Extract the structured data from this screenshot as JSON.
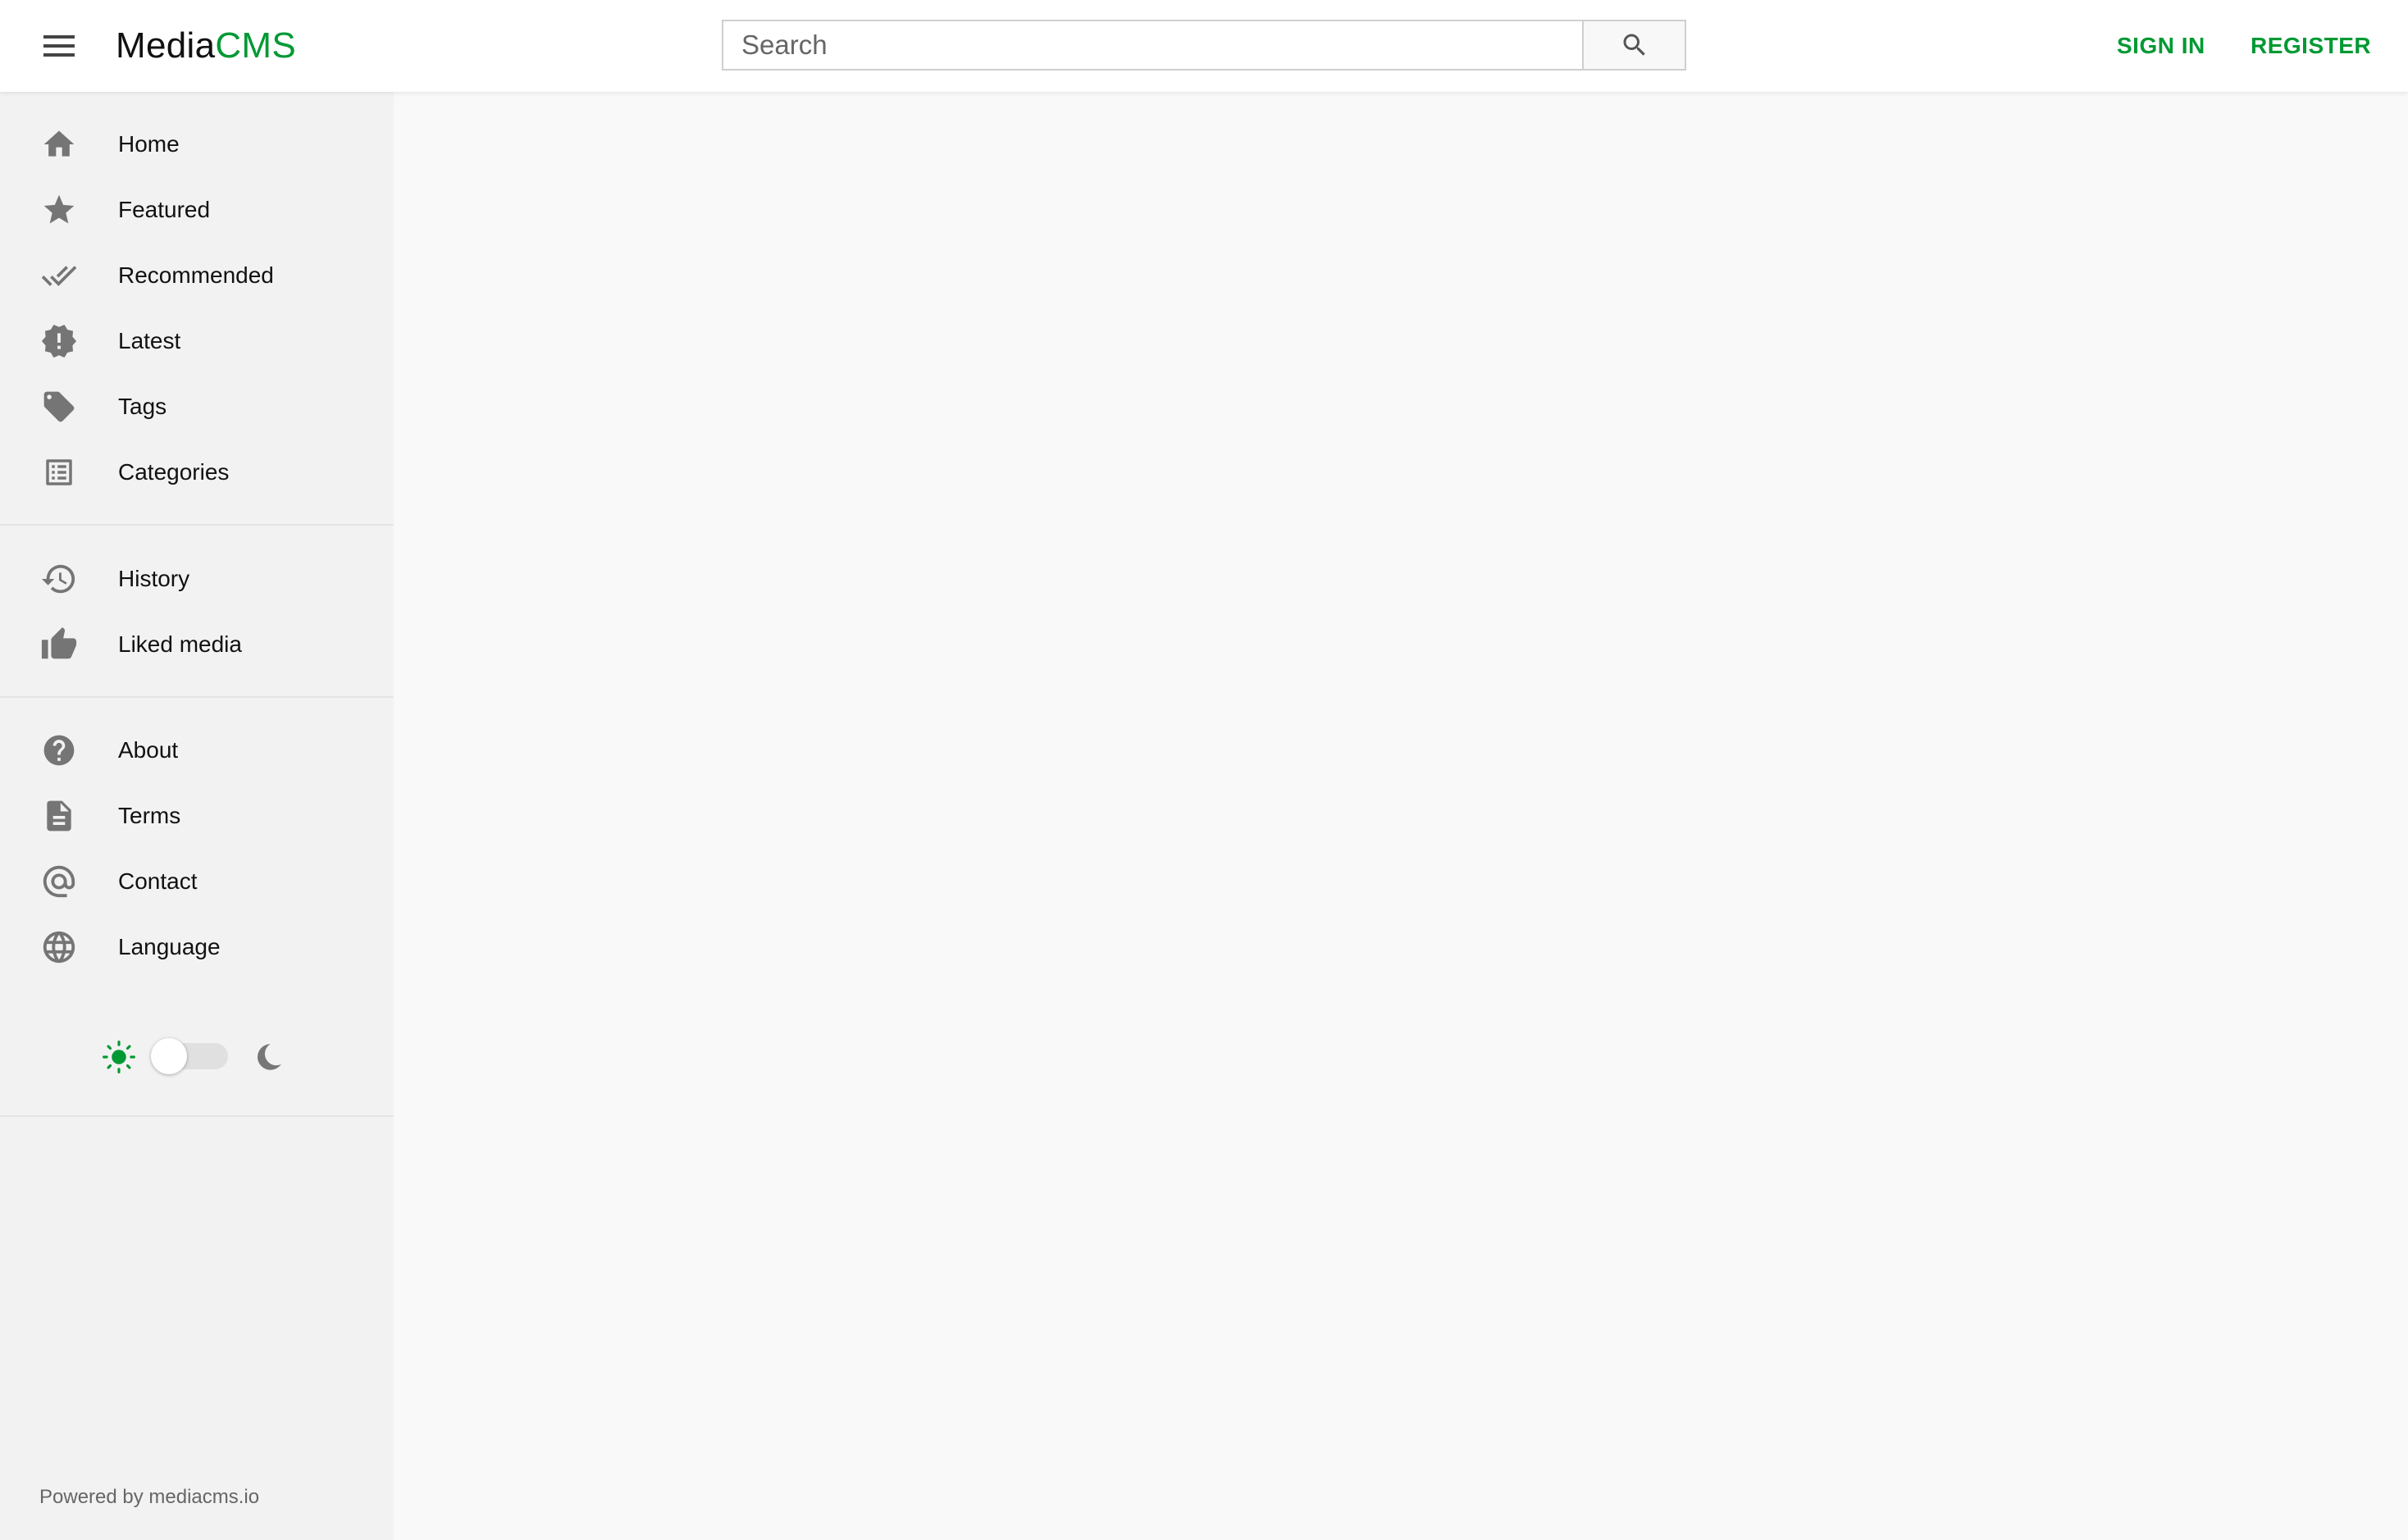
{
  "header": {
    "logo_part1": "Media",
    "logo_part2": "CMS",
    "search_placeholder": "Search",
    "sign_in_label": "SIGN IN",
    "register_label": "REGISTER",
    "accent_color": "#009933"
  },
  "sidebar": {
    "primary": [
      {
        "label": "Home",
        "icon": "home-icon"
      },
      {
        "label": "Featured",
        "icon": "star-icon"
      },
      {
        "label": "Recommended",
        "icon": "double-check-icon"
      },
      {
        "label": "Latest",
        "icon": "new-releases-icon"
      },
      {
        "label": "Tags",
        "icon": "tag-icon"
      },
      {
        "label": "Categories",
        "icon": "list-icon"
      }
    ],
    "secondary": [
      {
        "label": "History",
        "icon": "history-icon"
      },
      {
        "label": "Liked media",
        "icon": "thumb-up-icon"
      }
    ],
    "tertiary": [
      {
        "label": "About",
        "icon": "help-icon"
      },
      {
        "label": "Terms",
        "icon": "document-icon"
      },
      {
        "label": "Contact",
        "icon": "at-sign-icon"
      },
      {
        "label": "Language",
        "icon": "globe-icon"
      }
    ],
    "theme": {
      "mode": "light",
      "light_icon": "sun-icon",
      "dark_icon": "moon-icon"
    },
    "footer": "Powered by mediacms.io"
  }
}
